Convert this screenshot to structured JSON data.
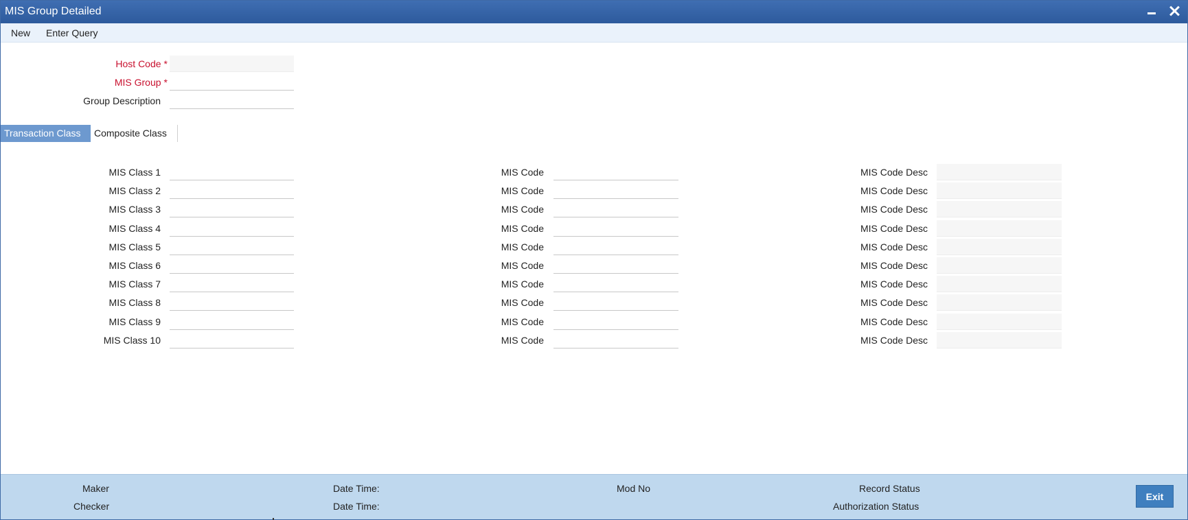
{
  "window": {
    "title": "MIS Group Detailed"
  },
  "toolbar": {
    "new_label": "New",
    "enter_query_label": "Enter Query"
  },
  "header_fields": {
    "host_code_label": "Host Code",
    "mis_group_label": "MIS Group",
    "group_description_label": "Group Description",
    "required_marker": "*",
    "host_code_value": "",
    "mis_group_value": "",
    "group_description_value": ""
  },
  "tabs": [
    {
      "label": "Transaction Class",
      "active": true
    },
    {
      "label": "Composite Class",
      "active": false
    }
  ],
  "mis_rows": [
    {
      "class_label": "MIS Class 1",
      "code_label": "MIS Code",
      "desc_label": "MIS Code Desc"
    },
    {
      "class_label": "MIS Class 2",
      "code_label": "MIS Code",
      "desc_label": "MIS Code Desc"
    },
    {
      "class_label": "MIS Class 3",
      "code_label": "MIS Code",
      "desc_label": "MIS Code Desc"
    },
    {
      "class_label": "MIS Class 4",
      "code_label": "MIS Code",
      "desc_label": "MIS Code Desc"
    },
    {
      "class_label": "MIS Class 5",
      "code_label": "MIS Code",
      "desc_label": "MIS Code Desc"
    },
    {
      "class_label": "MIS Class 6",
      "code_label": "MIS Code",
      "desc_label": "MIS Code Desc"
    },
    {
      "class_label": "MIS Class 7",
      "code_label": "MIS Code",
      "desc_label": "MIS Code Desc"
    },
    {
      "class_label": "MIS Class 8",
      "code_label": "MIS Code",
      "desc_label": "MIS Code Desc"
    },
    {
      "class_label": "MIS Class 9",
      "code_label": "MIS Code",
      "desc_label": "MIS Code Desc"
    },
    {
      "class_label": "MIS Class 10",
      "code_label": "MIS Code",
      "desc_label": "MIS Code Desc"
    }
  ],
  "footer": {
    "maker_label": "Maker",
    "checker_label": "Checker",
    "date_time_label_1": "Date Time:",
    "date_time_label_2": "Date Time:",
    "mod_no_label": "Mod No",
    "record_status_label": "Record Status",
    "authorization_status_label": "Authorization Status",
    "exit_label": "Exit"
  },
  "colors": {
    "titlebar": "#2d5a9c",
    "required_label": "#c8102e",
    "active_tab": "#6d99cf",
    "footer_bg": "#bfd8ee",
    "exit_button": "#3f7fbf"
  },
  "icons": {
    "minimize": "minimize-icon",
    "close": "close-icon"
  }
}
